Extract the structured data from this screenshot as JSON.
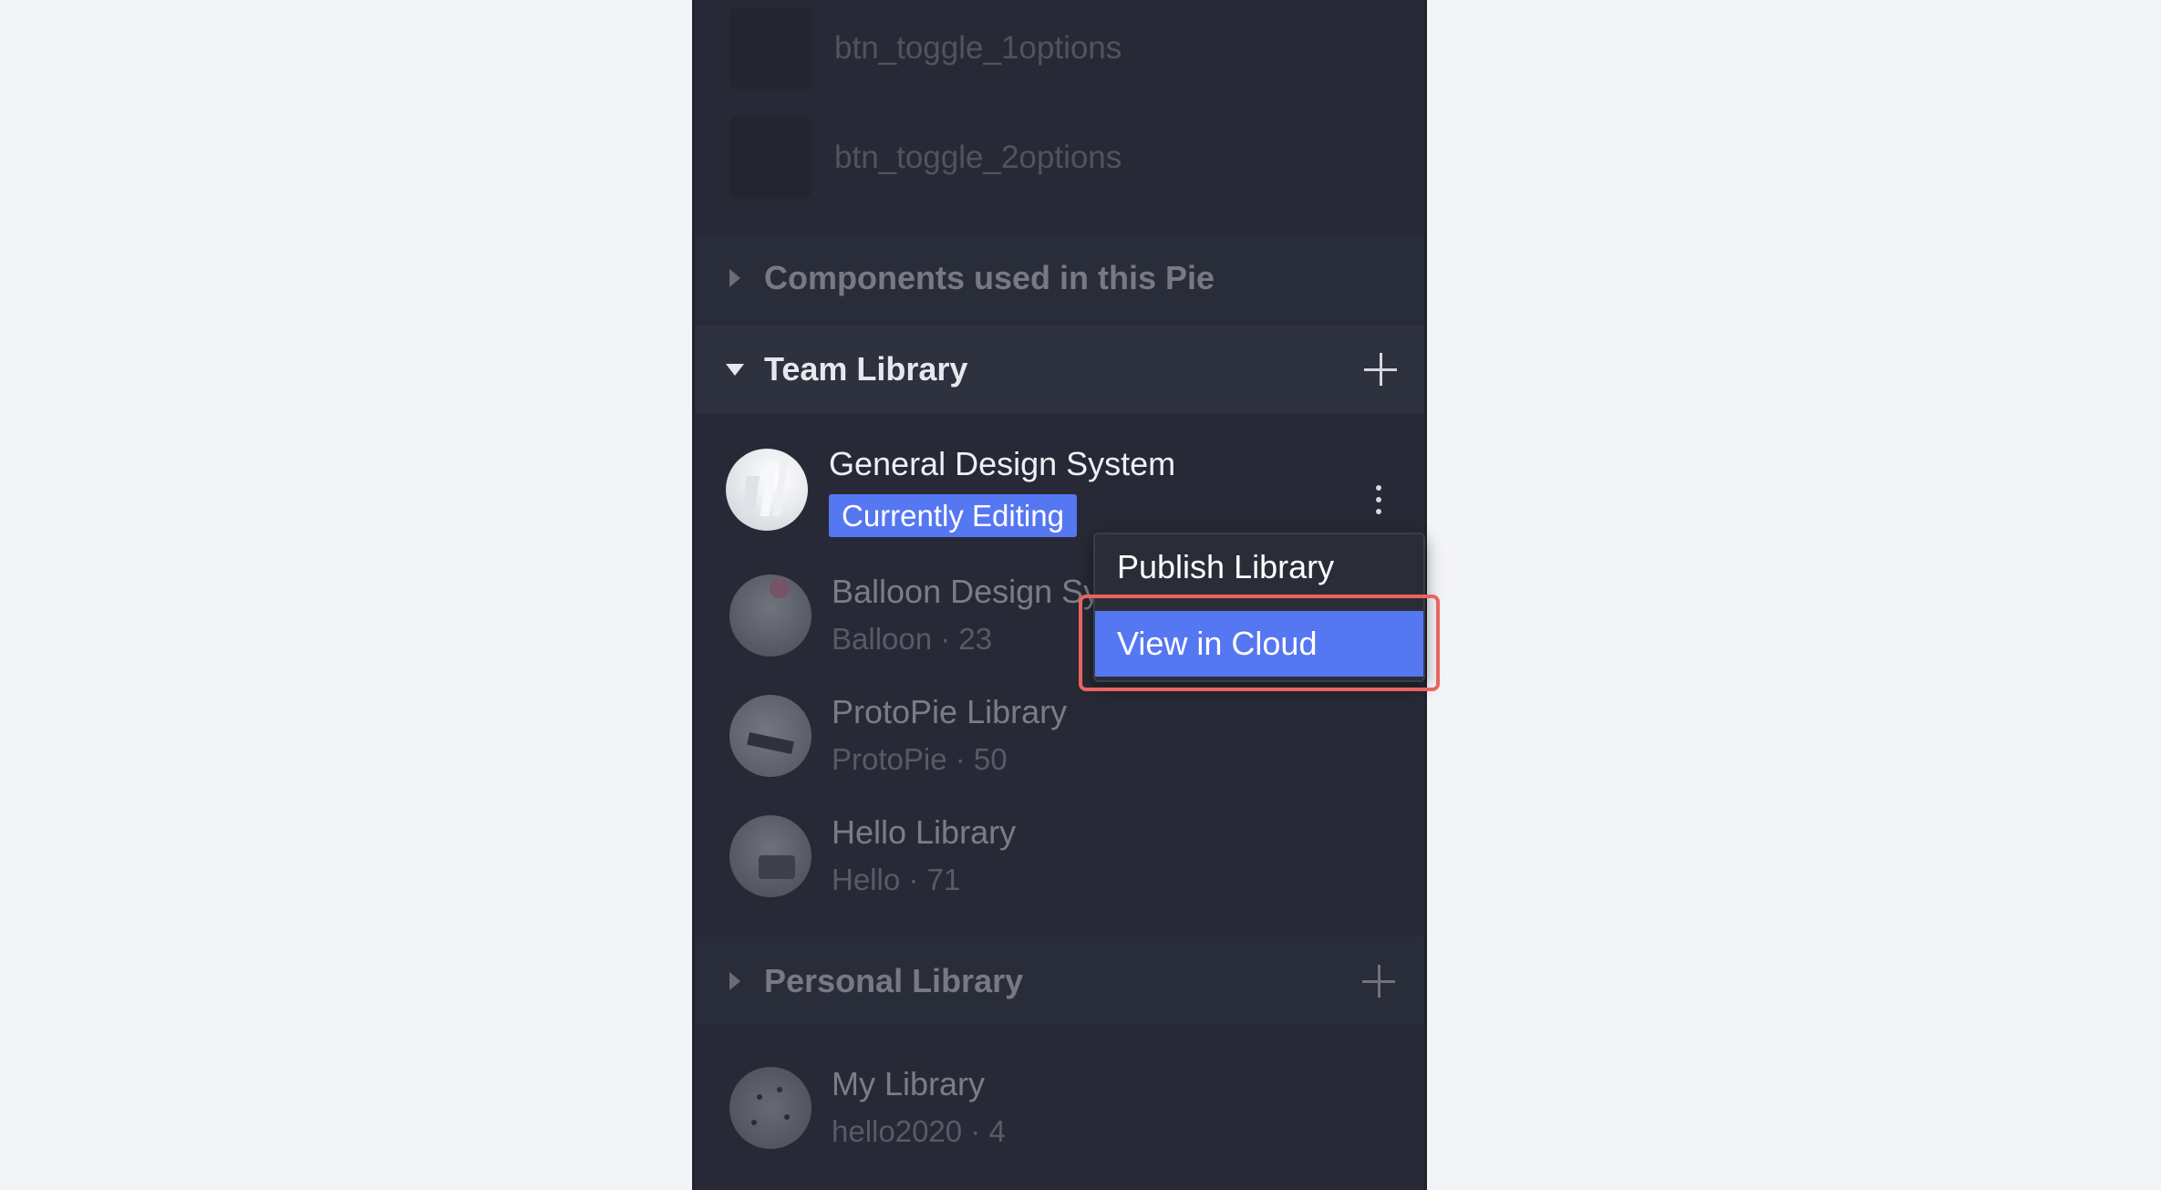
{
  "components": [
    {
      "label": "btn_toggle_1options"
    },
    {
      "label": "btn_toggle_2options"
    }
  ],
  "sections": {
    "components_used": {
      "label": "Components used in this Pie"
    },
    "team_library": {
      "label": "Team Library"
    },
    "personal_library": {
      "label": "Personal Library"
    }
  },
  "team_libraries": {
    "current": {
      "name": "General Design System",
      "badge": "Currently Editing"
    },
    "items": [
      {
        "name": "Balloon Design Sy",
        "sub": "Balloon · 23"
      },
      {
        "name": "ProtoPie Library",
        "sub": "ProtoPie · 50"
      },
      {
        "name": "Hello Library",
        "sub": "Hello · 71"
      }
    ]
  },
  "personal_libraries": {
    "items": [
      {
        "name": "My Library",
        "sub": "hello2020 · 4"
      }
    ]
  },
  "context_menu": {
    "items": [
      {
        "label": "Publish Library"
      },
      {
        "label": "View in Cloud",
        "active": true
      }
    ]
  },
  "colors": {
    "accent": "#5677f2",
    "highlight_outline": "#e8655f",
    "panel_bg": "#272a36",
    "page_bg": "#f3f4f8"
  }
}
